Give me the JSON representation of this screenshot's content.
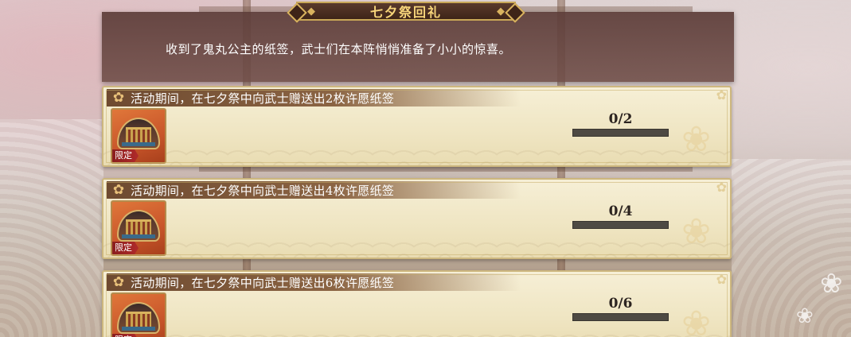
{
  "header": {
    "title": "七夕祭回礼",
    "description": "收到了鬼丸公主的纸签，武士们在本阵悄悄准备了小小的惊喜。"
  },
  "quests": [
    {
      "text": "活动期间，在七夕祭中向武士赠送出2枚许愿纸签",
      "progress_text": "0/2",
      "current": 0,
      "target": 2,
      "badge": "限定"
    },
    {
      "text": "活动期间，在七夕祭中向武士赠送出4枚许愿纸签",
      "progress_text": "0/4",
      "current": 0,
      "target": 4,
      "badge": "限定"
    },
    {
      "text": "活动期间，在七夕祭中向武士赠送出6枚许愿纸签",
      "progress_text": "0/6",
      "current": 0,
      "target": 6,
      "badge": "限定"
    }
  ],
  "colors": {
    "title_gold": "#f7d57a",
    "banner_brown": "#6e4a30",
    "progress_track": "#4e4a43",
    "badge_red": "#b02a2a"
  }
}
